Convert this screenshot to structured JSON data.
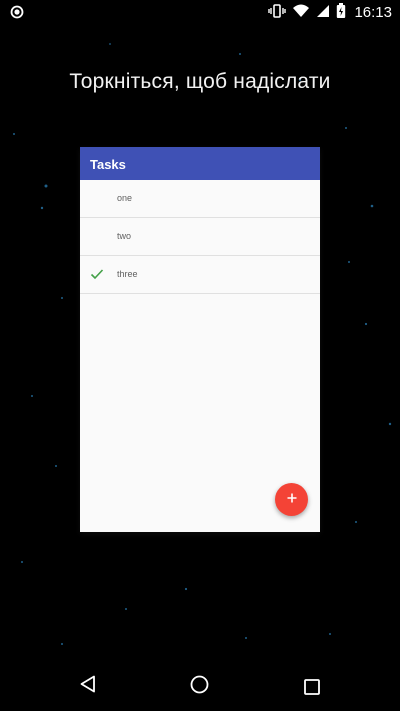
{
  "status_bar": {
    "left_icon": "circle-status-icon",
    "icons": [
      "vibrate-icon",
      "wifi-icon",
      "signal-icon",
      "battery-charging-icon"
    ],
    "time": "16:13"
  },
  "overlay": {
    "prompt": "Торкніться, щоб надіслати"
  },
  "app": {
    "title": "Tasks",
    "accent_color": "#3f51b5",
    "fab_color": "#f44336",
    "tasks": [
      {
        "label": "one",
        "done": false
      },
      {
        "label": "two",
        "done": false
      },
      {
        "label": "three",
        "done": true
      }
    ],
    "fab_icon": "plus-icon",
    "check_icon": "check-icon"
  },
  "nav_bar": {
    "buttons": [
      "back-icon",
      "home-icon",
      "recents-icon"
    ]
  }
}
